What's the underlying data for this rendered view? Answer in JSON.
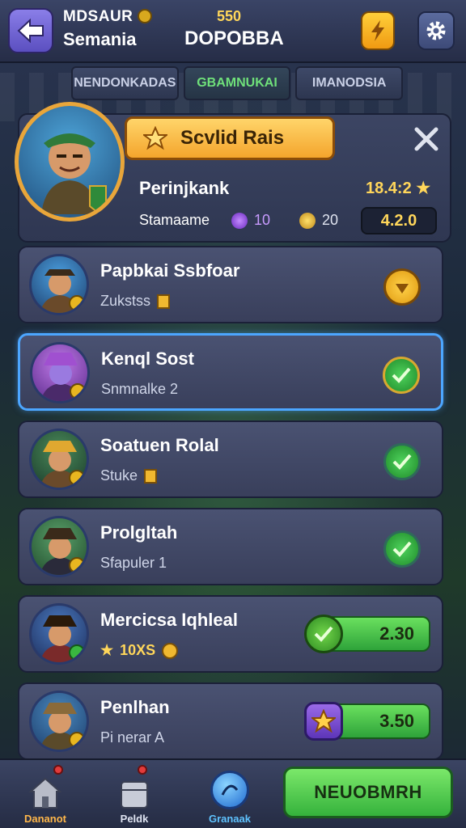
{
  "header": {
    "title_line1": "MDSAUR",
    "title_line2": "Semania",
    "top_number": "550",
    "center_title": "DOPOBBA"
  },
  "tabs": [
    {
      "label": "NENDONKADAS",
      "active": false
    },
    {
      "label": "GBAMNUKAI",
      "active": true
    },
    {
      "label": "IMANODSIA",
      "active": false
    }
  ],
  "panel": {
    "banner_label": "Scvlid Rais",
    "rank_label": "Perinjkank",
    "rank_value": "18.4:2",
    "stat_label": "Stamaame",
    "stat_a": "10",
    "stat_b": "20",
    "score": "4.2.0"
  },
  "rows": [
    {
      "title": "Papbkai Ssbfoar",
      "subtitle": "Zukstss",
      "action": "gold-coin"
    },
    {
      "title": "Kenql Sost",
      "subtitle": "Snmnalke 2",
      "action": "gold-check",
      "selected": true
    },
    {
      "title": "Soatuen Rolal",
      "subtitle": "Stuke",
      "action": "green-check"
    },
    {
      "title": "Prolgltah",
      "subtitle": "Sfapuler 1",
      "action": "green-check"
    },
    {
      "title": "Mercicsa Iqhleal",
      "subtitle": "10XS",
      "price": "2.30",
      "price_icon": "green-check-badge"
    },
    {
      "title": "Penlhan",
      "subtitle": "Pi nerar A",
      "price": "3.50",
      "price_icon": "purple-star-badge"
    }
  ],
  "bottom_nav": [
    {
      "label": "Dananot",
      "icon": "house-icon"
    },
    {
      "label": "Peldk",
      "icon": "box-icon"
    },
    {
      "label": "Granaak",
      "icon": "blue-orb-icon"
    }
  ],
  "cta_label": "NEUOBMRH",
  "colors": {
    "accent_gold": "#ffd65a",
    "accent_green": "#6fe07a",
    "selection_blue": "#4ca6ff"
  }
}
